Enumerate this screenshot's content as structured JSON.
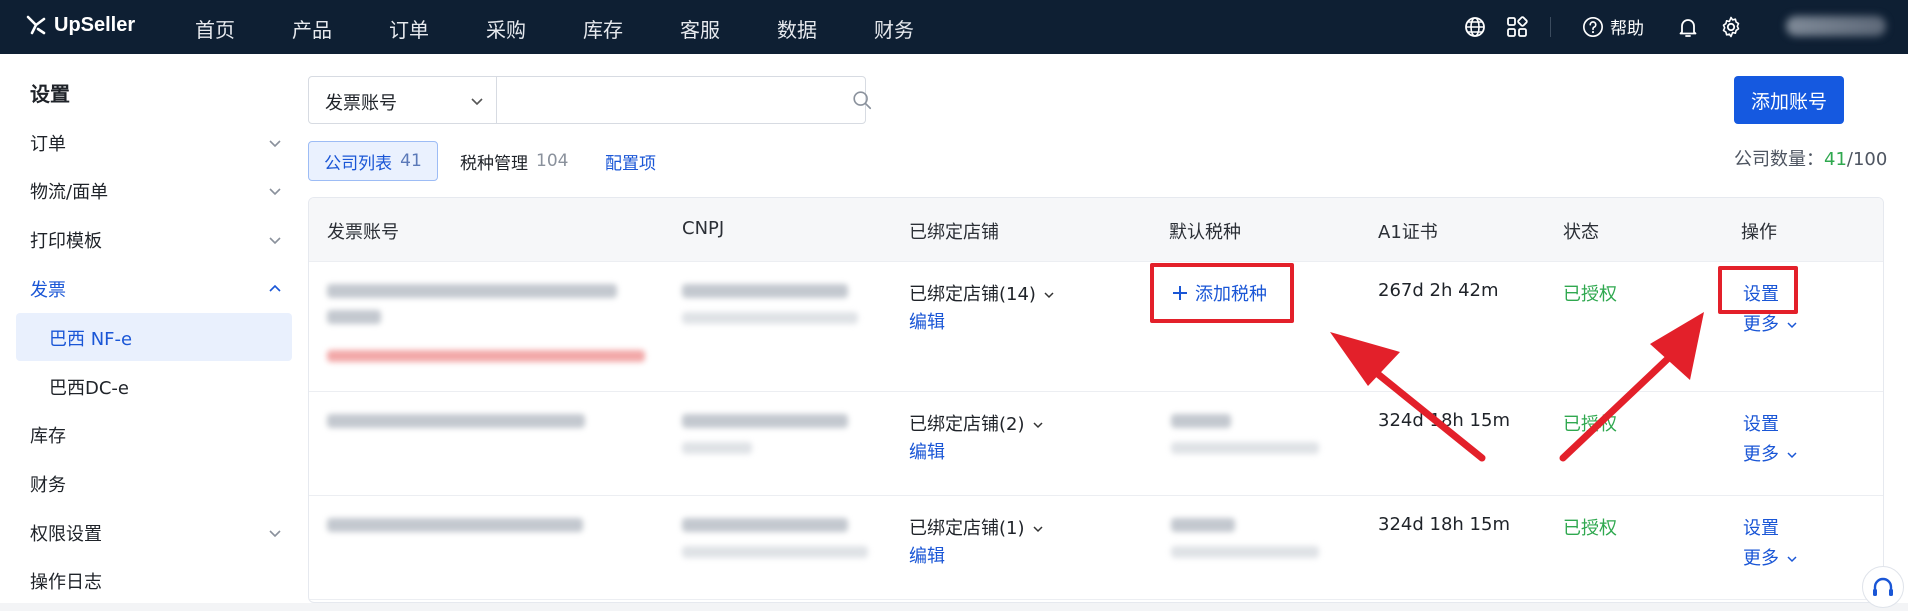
{
  "topbar": {
    "brand": "UpSeller",
    "nav": [
      "首页",
      "产品",
      "订单",
      "采购",
      "库存",
      "客服",
      "数据",
      "财务"
    ],
    "help_label": "帮助",
    "icons": [
      "globe-icon",
      "apps-icon",
      "help-icon",
      "bell-icon",
      "gear-icon"
    ]
  },
  "sidebar": {
    "title": "设置",
    "items": [
      {
        "label": "订单",
        "expandable": true
      },
      {
        "label": "物流/面单",
        "expandable": true
      },
      {
        "label": "打印模板",
        "expandable": true
      },
      {
        "label": "发票",
        "expandable": true,
        "expanded": true
      },
      {
        "label": "巴西 NF-e",
        "sub": true,
        "selected": true
      },
      {
        "label": "巴西DC-e",
        "sub": true
      },
      {
        "label": "库存"
      },
      {
        "label": "财务"
      },
      {
        "label": "权限设置",
        "expandable": true
      },
      {
        "label": "操作日志"
      }
    ]
  },
  "filter": {
    "select_value": "发票账号",
    "search_value": ""
  },
  "add_account_label": "添加账号",
  "tabs": [
    {
      "label": "公司列表",
      "count": "41",
      "selected": true
    },
    {
      "label": "税种管理",
      "count": "104"
    },
    {
      "label": "配置项",
      "count": ""
    }
  ],
  "company_count": {
    "label": "公司数量：",
    "used": "41",
    "total": "/100"
  },
  "table": {
    "headers": [
      "发票账号",
      "CNPJ",
      "已绑定店铺",
      "默认税种",
      "A1证书",
      "状态",
      "操作"
    ],
    "rows": [
      {
        "shops": "已绑定店铺(14)",
        "edit": "编辑",
        "tax_action": "添加税种",
        "cert": "267d 2h 42m",
        "status": "已授权",
        "action": "设置",
        "more": "更多"
      },
      {
        "shops": "已绑定店铺(2)",
        "edit": "编辑",
        "tax_action": "",
        "cert": "324d 18h 15m",
        "status": "已授权",
        "action": "设置",
        "more": "更多"
      },
      {
        "shops": "已绑定店铺(1)",
        "edit": "编辑",
        "tax_action": "",
        "cert": "324d 18h 15m",
        "status": "已授权",
        "action": "设置",
        "more": "更多"
      }
    ]
  },
  "colors": {
    "topbar": "#0e1f33",
    "accent": "#1559e0",
    "authorized": "#2fa84f",
    "annotation": "#e3202a"
  }
}
